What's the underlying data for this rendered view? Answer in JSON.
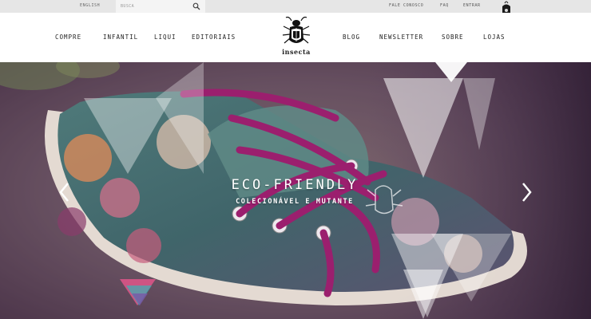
{
  "topbar": {
    "language": "ENGLISH",
    "search_placeholder": "BUSCA",
    "links": [
      "FALE CONOSCO",
      "FAQ",
      "ENTRAR"
    ]
  },
  "nav": {
    "left": [
      "COMPRE",
      "INFANTIL",
      "LIQUI",
      "EDITORIAIS"
    ],
    "right": [
      "BLOG",
      "NEWSLETTER",
      "SOBRE",
      "LOJAS"
    ],
    "logo_text": "insecta"
  },
  "hero": {
    "title": "ECO-FRIENDLY",
    "subtitle": "COLECIONÁVEL E MUTANTE"
  },
  "icons": {
    "search": "search-icon",
    "bag": "shopping-bag-icon",
    "logo": "beetle-logo-icon",
    "prev": "chevron-left-icon",
    "next": "chevron-right-icon"
  },
  "colors": {
    "topbar_bg": "#e6e6e6",
    "nav_bg": "#ffffff",
    "hero_tint": "#6b3a6a",
    "lace": "#9b1f6e"
  }
}
